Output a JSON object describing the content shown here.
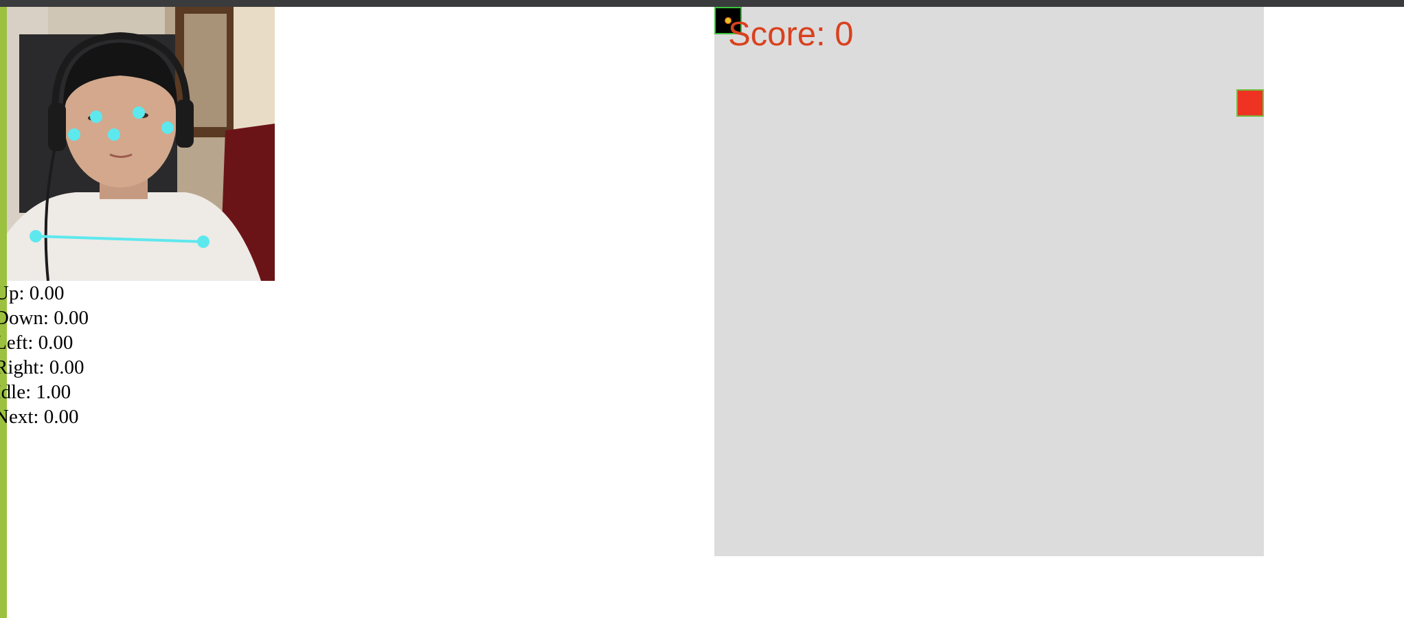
{
  "predictions": [
    {
      "label": "Up",
      "value": "0.00"
    },
    {
      "label": "Down",
      "value": "0.00"
    },
    {
      "label": "Left",
      "value": "0.00"
    },
    {
      "label": "Right",
      "value": "0.00"
    },
    {
      "label": "Idle",
      "value": "1.00"
    },
    {
      "label": "Next",
      "value": "0.00"
    }
  ],
  "game": {
    "score_text": "Score: 0"
  },
  "colors": {
    "score": "#d9411e",
    "board": "#dcdcdc",
    "food": "#ee3322",
    "snake_border": "#3bc23b",
    "keypoints": "#5de8ee",
    "accent_stripe": "#9bc13f"
  },
  "icons": {
    "snake_head": "snake-head-icon",
    "food": "food-icon"
  }
}
